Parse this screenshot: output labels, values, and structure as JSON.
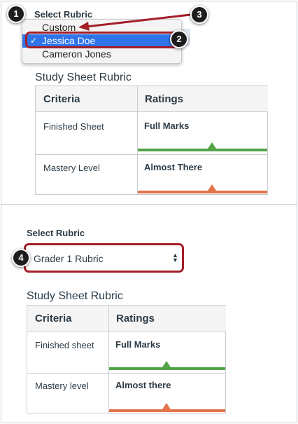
{
  "top": {
    "select_label": "Select Rubric",
    "menu_items": [
      {
        "label": "Custom",
        "selected": false
      },
      {
        "label": "Jessica Doe",
        "selected": true
      },
      {
        "label": "Cameron Jones",
        "selected": false
      }
    ],
    "check_glyph": "✓",
    "rubric_title": "Study Sheet Rubric",
    "headers": {
      "criteria": "Criteria",
      "ratings": "Ratings"
    },
    "rows": [
      {
        "criteria": "Finished Sheet",
        "rating": "Full Marks",
        "color": "#52a447"
      },
      {
        "criteria": "Mastery Level",
        "rating": "Almost There",
        "color": "#e2744a"
      }
    ]
  },
  "bottom": {
    "select_label": "Select Rubric",
    "select_value": "Grader 1 Rubric",
    "rubric_title": "Study Sheet Rubric",
    "headers": {
      "criteria": "Criteria",
      "ratings": "Ratings"
    },
    "rows": [
      {
        "criteria": "Finished sheet",
        "rating": "Full Marks",
        "color": "#52a447"
      },
      {
        "criteria": "Mastery level",
        "rating": "Almost there",
        "color": "#e2744a"
      }
    ]
  },
  "callouts": [
    "1",
    "2",
    "3",
    "4"
  ],
  "colors": {
    "highlight": "#a31f27",
    "selected": "#2f74e8",
    "callout": "#1d1d1d"
  }
}
